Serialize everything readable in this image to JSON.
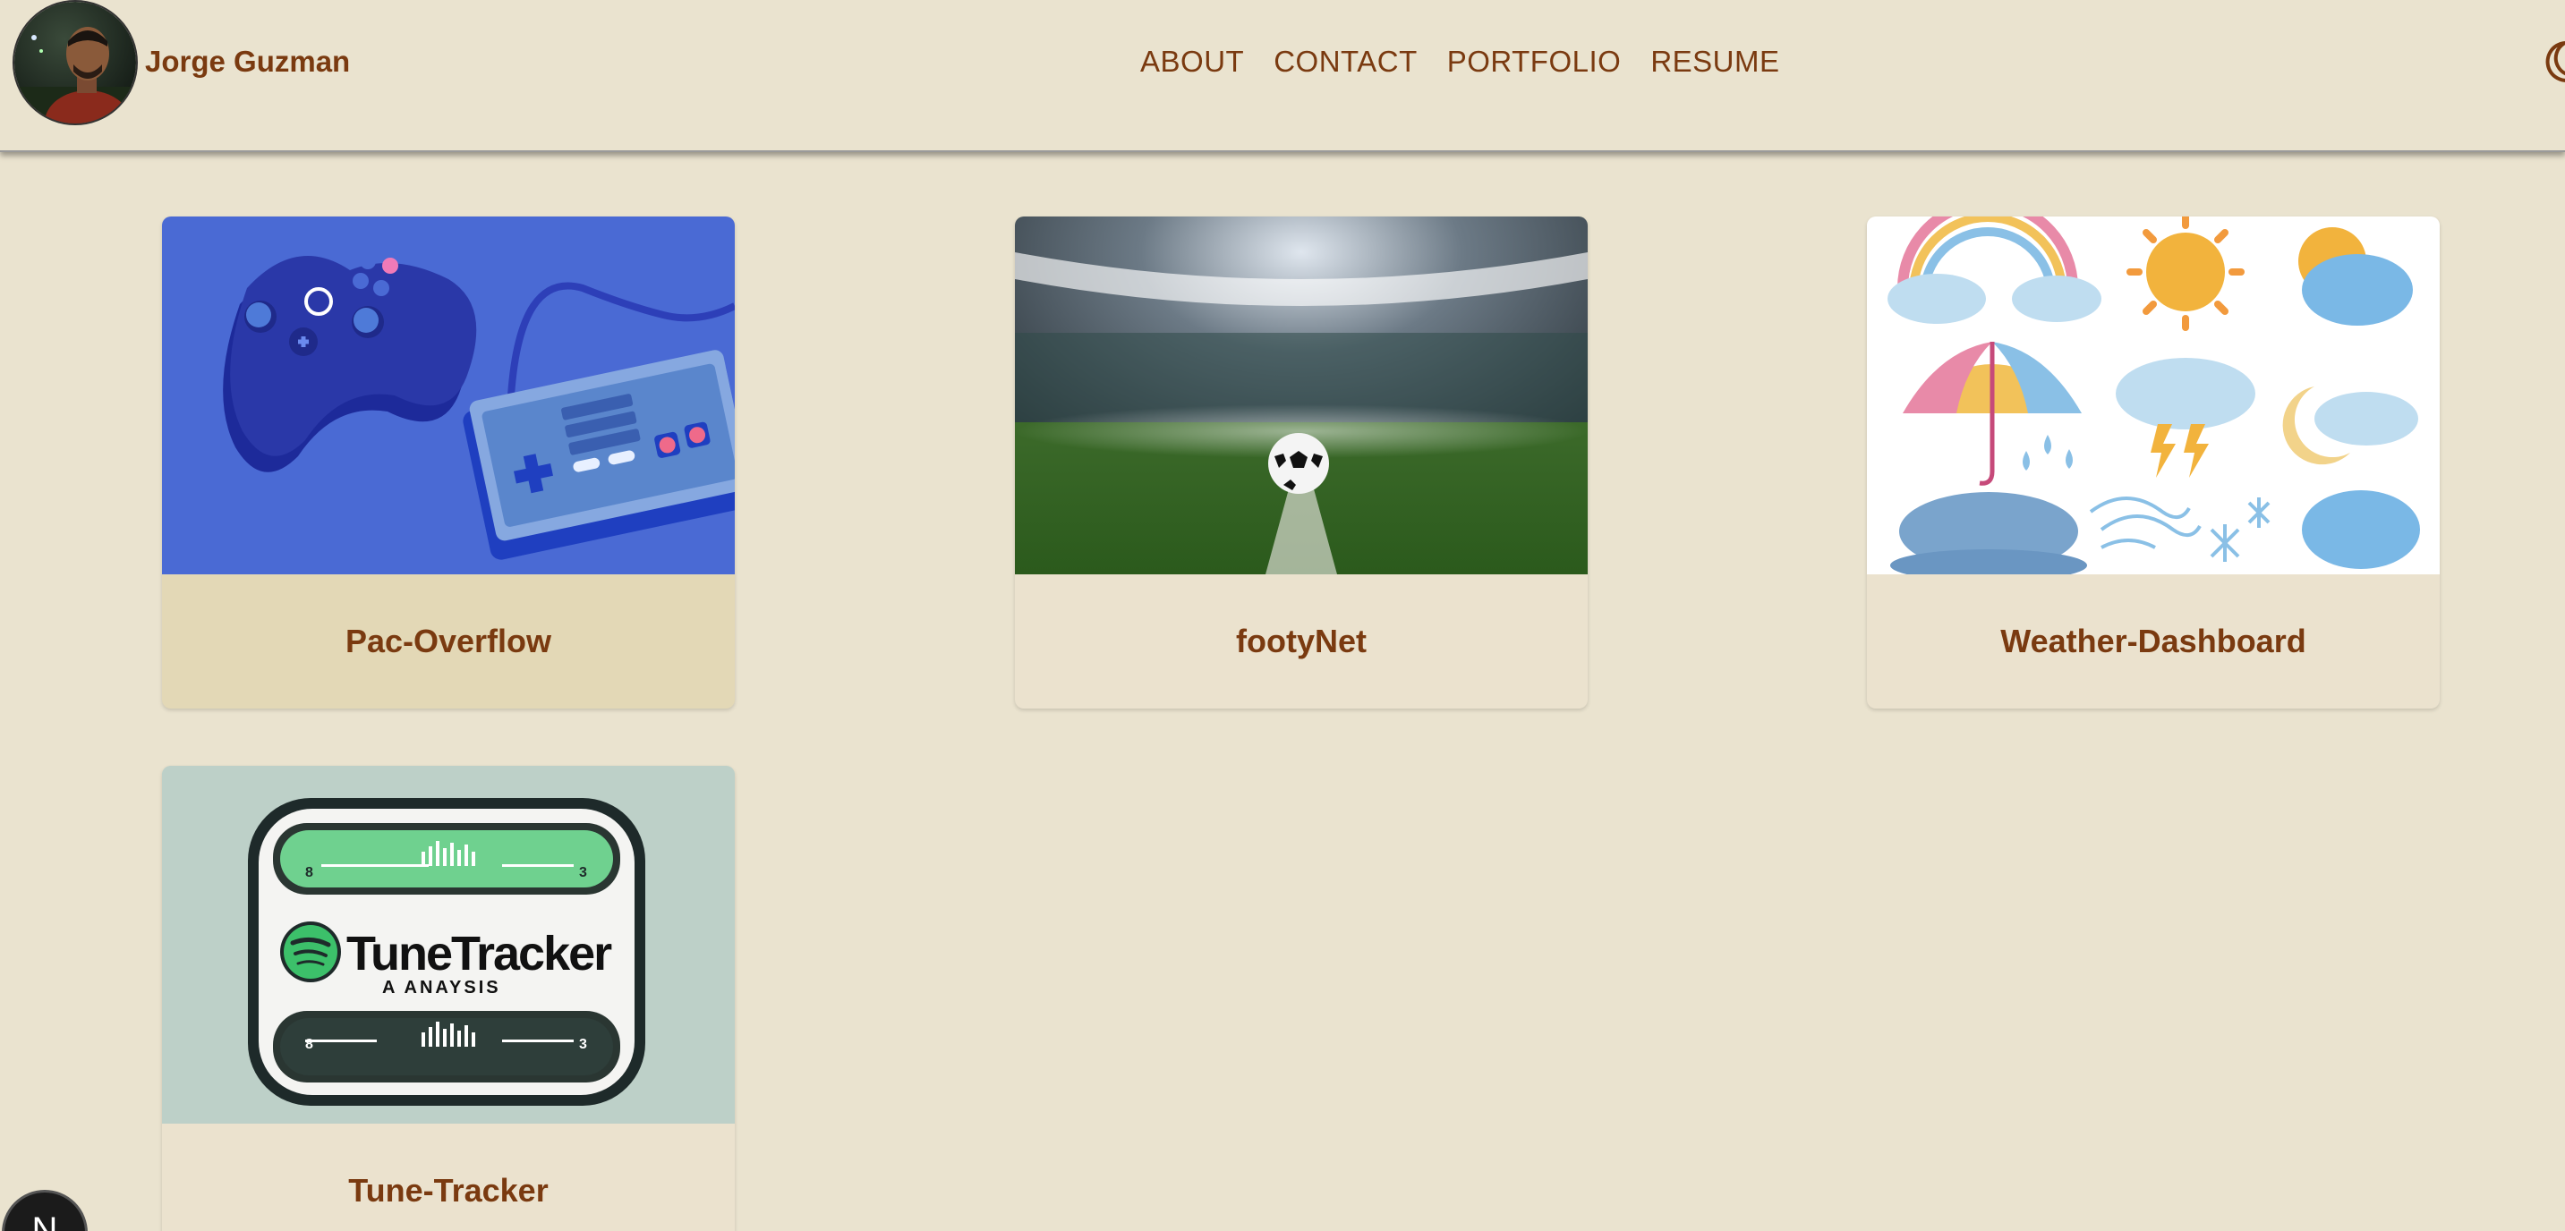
{
  "header": {
    "brand_name": "Jorge Guzman",
    "nav": [
      "ABOUT",
      "CONTACT",
      "PORTFOLIO",
      "RESUME"
    ],
    "theme_icon": "moon-icon"
  },
  "projects": [
    {
      "title": "Pac-Overflow",
      "thumbnail": "game-controllers-illustration"
    },
    {
      "title": "footyNet",
      "thumbnail": "soccer-ball-stadium-photo"
    },
    {
      "title": "Weather-Dashboard",
      "thumbnail": "watercolor-weather-icons"
    },
    {
      "title": "Tune-Tracker",
      "thumbnail": "tunetracker-logo"
    }
  ],
  "tunetracker_logo": {
    "name": "TuneTracker",
    "tagline": "A ANAYSIS",
    "left_num": "8",
    "right_num": "3"
  },
  "dev_badge": "N",
  "colors": {
    "background": "#eae3cf",
    "accent": "#7a3a10",
    "active_card": "#e3d8b6"
  }
}
